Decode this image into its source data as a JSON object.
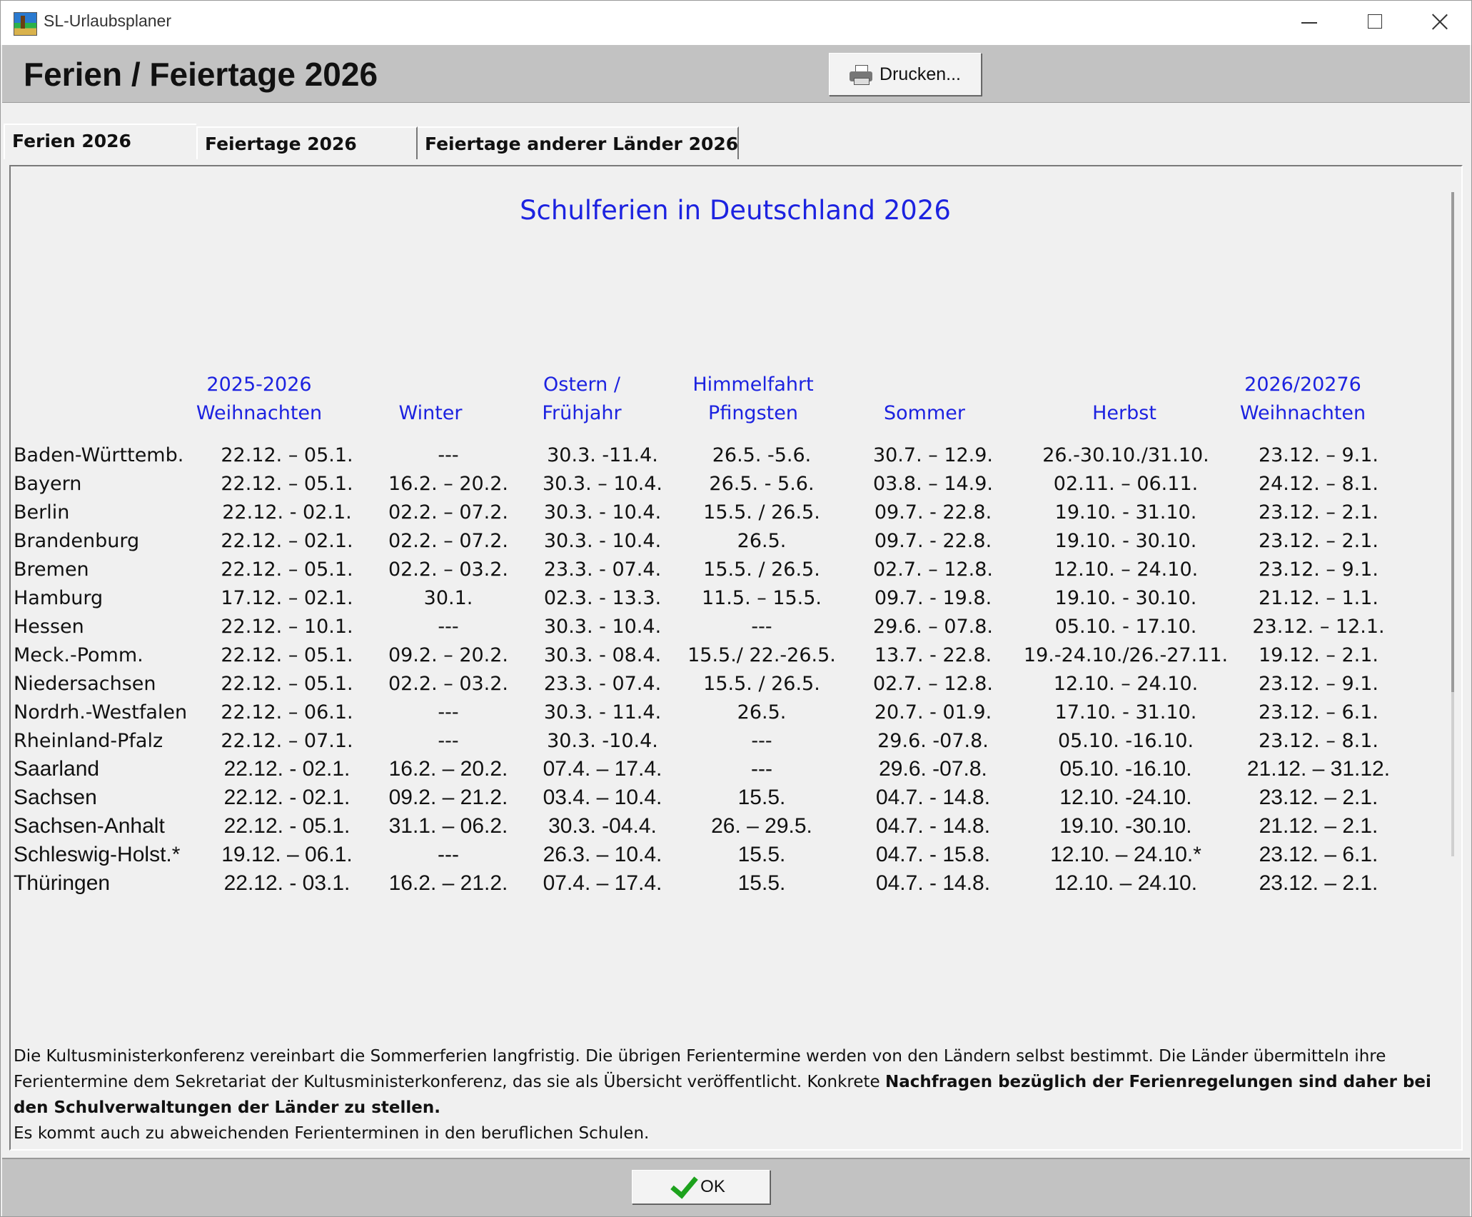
{
  "window": {
    "title": "SL-Urlaubsplaner"
  },
  "header": {
    "title": "Ferien / Feiertage 2026",
    "print_label": "Drucken..."
  },
  "tabs": [
    {
      "label": "Ferien 2026",
      "active": true
    },
    {
      "label": "Feiertage 2026",
      "active": false
    },
    {
      "label": "Feiertage anderer Länder 2026",
      "active": false
    }
  ],
  "content": {
    "title": "Schulferien in Deutschland 2026",
    "columns": [
      {
        "line1": "2025-2026",
        "line2": "Weihnachten"
      },
      {
        "line1": "",
        "line2": "Winter"
      },
      {
        "line1": "Ostern /",
        "line2": "Frühjahr"
      },
      {
        "line1": "Himmelfahrt",
        "line2": "Pfingsten"
      },
      {
        "line1": "",
        "line2": "Sommer"
      },
      {
        "line1": "",
        "line2": "Herbst"
      },
      {
        "line1": "2026/20276",
        "line2": "Weihnachten"
      }
    ],
    "rows": [
      {
        "land": "Baden-Württemb.",
        "values": [
          "22.12. – 05.1.",
          "---",
          "30.3. -11.4.",
          "26.5. -5.6.",
          "30.7. – 12.9.",
          "26.-30.10./31.10.",
          "23.12. – 9.1."
        ]
      },
      {
        "land": "Bayern",
        "values": [
          "22.12. – 05.1.",
          "16.2. – 20.2.",
          "30.3. – 10.4.",
          "26.5. - 5.6.",
          "03.8. – 14.9.",
          "02.11. – 06.11.",
          "24.12. – 8.1."
        ]
      },
      {
        "land": "Berlin",
        "values": [
          "22.12. - 02.1.",
          "02.2. – 07.2.",
          "30.3. - 10.4.",
          "15.5. / 26.5.",
          "09.7. - 22.8.",
          "19.10. - 31.10.",
          "23.12. – 2.1."
        ]
      },
      {
        "land": "Brandenburg",
        "values": [
          "22.12. – 02.1.",
          "02.2. – 07.2.",
          "30.3. - 10.4.",
          "26.5.",
          "09.7. - 22.8.",
          "19.10. - 30.10.",
          "23.12. – 2.1."
        ]
      },
      {
        "land": "Bremen",
        "values": [
          "22.12. – 05.1.",
          "02.2. – 03.2.",
          "23.3. - 07.4.",
          "15.5. / 26.5.",
          "02.7. – 12.8.",
          "12.10. – 24.10.",
          "23.12. – 9.1."
        ]
      },
      {
        "land": "Hamburg",
        "values": [
          "17.12. – 02.1.",
          "30.1.",
          "02.3. - 13.3.",
          "11.5. – 15.5.",
          "09.7. - 19.8.",
          "19.10. - 30.10.",
          "21.12. – 1.1."
        ]
      },
      {
        "land": "Hessen",
        "values": [
          "22.12. – 10.1.",
          "---",
          "30.3. - 10.4.",
          "---",
          "29.6. – 07.8.",
          "05.10. - 17.10.",
          "23.12. – 12.1."
        ]
      },
      {
        "land": "Meck.-Pomm.",
        "values": [
          "22.12. – 05.1.",
          "09.2. – 20.2.",
          "30.3. - 08.4.",
          "15.5./ 22.-26.5.",
          "13.7. - 22.8.",
          "19.-24.10./26.-27.11.",
          "19.12. – 2.1."
        ]
      },
      {
        "land": "Niedersachsen",
        "values": [
          "22.12. – 05.1.",
          "02.2. – 03.2.",
          "23.3. - 07.4.",
          "15.5. / 26.5.",
          "02.7. – 12.8.",
          "12.10. – 24.10.",
          "23.12. – 9.1."
        ]
      },
      {
        "land": "Nordrh.-Westfalen",
        "values": [
          "22.12. – 06.1.",
          "---",
          "30.3. - 11.4.",
          "26.5.",
          "20.7. - 01.9.",
          "17.10. - 31.10.",
          "23.12. – 6.1."
        ]
      },
      {
        "land": "Rheinland-Pfalz",
        "values": [
          "22.12. – 07.1.",
          "---",
          "30.3. -10.4.",
          "---",
          "29.6. -07.8.",
          "05.10. -16.10.",
          "23.12. – 8.1."
        ]
      },
      {
        "land": "Saarland",
        "values": [
          "22.12. - 02.1.",
          "16.2. – 20.2.",
          "07.4. – 17.4.",
          "---",
          "29.6. -07.8.",
          "05.10. -16.10.",
          "21.12. – 31.12."
        ]
      },
      {
        "land": "Sachsen",
        "values": [
          "22.12. - 02.1.",
          "09.2. – 21.2.",
          "03.4. – 10.4.",
          "15.5.",
          "04.7. - 14.8.",
          "12.10. -24.10.",
          "23.12. – 2.1."
        ]
      },
      {
        "land": "Sachsen-Anhalt",
        "values": [
          "22.12. - 05.1.",
          "31.1. – 06.2.",
          "30.3. -04.4.",
          "26. – 29.5.",
          "04.7. - 14.8.",
          "19.10. -30.10.",
          "21.12. – 2.1."
        ]
      },
      {
        "land": "Schleswig-Holst.*",
        "values": [
          "19.12. – 06.1.",
          "---",
          "26.3. – 10.4.",
          "15.5.",
          "04.7. - 15.8.",
          "12.10. – 24.10.*",
          "23.12. – 6.1."
        ]
      },
      {
        "land": "Thüringen",
        "values": [
          "22.12. - 03.1.",
          "16.2. – 21.2.",
          "07.4. – 17.4.",
          "15.5.",
          "04.7. - 14.8.",
          "12.10. – 24.10.",
          "23.12. – 2.1."
        ]
      }
    ],
    "footer": {
      "part1": "Die Kultusministerkonferenz vereinbart die Sommerferien langfristig. Die übrigen Ferientermine werden von den Ländern selbst bestimmt. Die Länder übermitteln ihre Ferientermine dem Sekretariat der Kultusministerkonferenz, das sie als Übersicht veröffentlicht. Konkrete ",
      "bold": "Nachfragen bezüglich der Ferienregelungen sind daher bei den Schulverwaltungen der Länder zu stellen.",
      "line2": "Es kommt auch zu abweichenden Ferienterminen in den beruflichen Schulen."
    }
  },
  "bottom": {
    "ok_label": "OK"
  },
  "colors": {
    "accent_blue": "#1c22e0",
    "header_gray": "#c2c2c2",
    "ok_check": "#1da21d"
  }
}
